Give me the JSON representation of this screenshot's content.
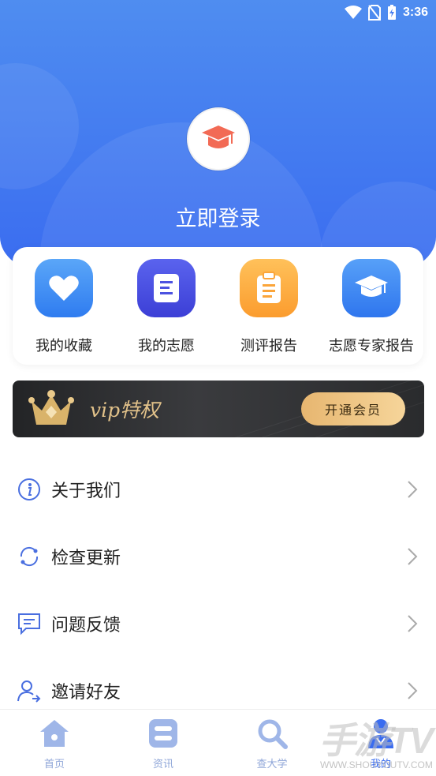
{
  "status_bar": {
    "time": "3:36"
  },
  "profile": {
    "login_label": "立即登录"
  },
  "quick_actions": [
    {
      "label": "我的收藏",
      "icon": "heart-icon",
      "color": "#3a8cf4"
    },
    {
      "label": "我的志愿",
      "icon": "document-icon",
      "color": "#4c52e0"
    },
    {
      "label": "测评报告",
      "icon": "clipboard-icon",
      "color": "#fba53a"
    },
    {
      "label": "志愿专家报告",
      "icon": "graduation-cap-icon",
      "color": "#3a82f4"
    }
  ],
  "vip": {
    "title": "vip特权",
    "button_label": "开通会员",
    "icon": "crown-icon"
  },
  "menu": [
    {
      "label": "关于我们",
      "icon": "info-icon"
    },
    {
      "label": "检查更新",
      "icon": "refresh-icon"
    },
    {
      "label": "问题反馈",
      "icon": "feedback-icon"
    },
    {
      "label": "邀请好友",
      "icon": "invite-user-icon"
    }
  ],
  "tabs": [
    {
      "label": "首页",
      "icon": "home-icon",
      "active": false
    },
    {
      "label": "资讯",
      "icon": "news-icon",
      "active": false
    },
    {
      "label": "查大学",
      "icon": "search-icon",
      "active": false
    },
    {
      "label": "我的",
      "icon": "user-icon",
      "active": true
    }
  ],
  "watermark": {
    "big": "手游TV",
    "small": "WWW.SHOUYOUTV.COM"
  },
  "colors": {
    "primary": "#3a6cf0",
    "gold": "#e2c28a",
    "vip_bg": "#2a2b2d"
  }
}
